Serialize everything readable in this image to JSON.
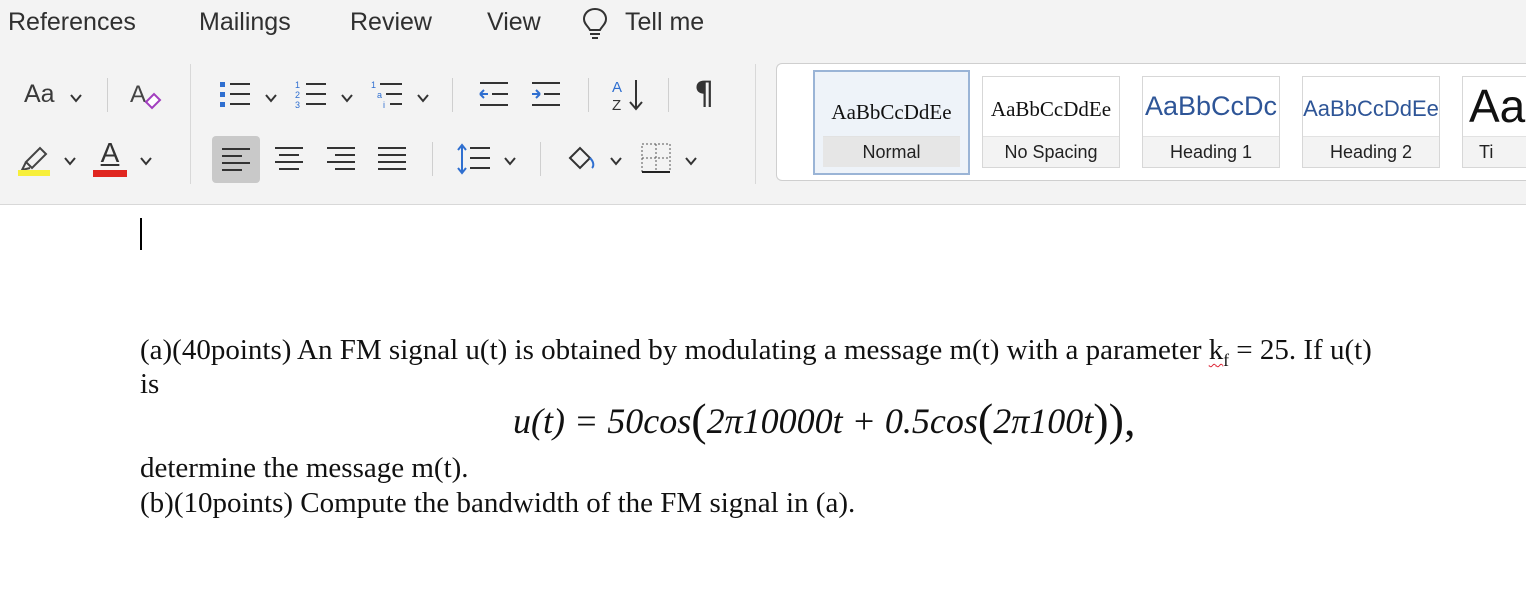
{
  "tabs": [
    {
      "label": "References"
    },
    {
      "label": "Mailings"
    },
    {
      "label": "Review"
    },
    {
      "label": "View"
    },
    {
      "label": "Tell me"
    }
  ],
  "font_size_label": "Aa",
  "font_color_letter": "A",
  "colors": {
    "highlight": "#f7ef3a",
    "font_color": "#e0261f",
    "selected_style_border": "#9ab4d6",
    "list_blue": "#2f6fd0"
  },
  "icons": [
    "lightbulb-icon",
    "clear-formatting-icon",
    "bullets-icon",
    "numbering-icon",
    "multilevel-list-icon",
    "decrease-indent-icon",
    "increase-indent-icon",
    "sort-icon",
    "pilcrow-icon",
    "highlighter-icon",
    "font-color-icon",
    "align-left-icon",
    "align-center-icon",
    "align-right-icon",
    "justify-icon",
    "line-spacing-icon",
    "shading-icon",
    "borders-icon"
  ],
  "styles": [
    {
      "preview": "AaBbCcDdEe",
      "label": "Normal"
    },
    {
      "preview": "AaBbCcDdEe",
      "label": "No Spacing"
    },
    {
      "preview": "AaBbCcDc",
      "label": "Heading 1"
    },
    {
      "preview": "AaBbCcDdEe",
      "label": "Heading 2"
    },
    {
      "preview": "Aa",
      "label": "Ti"
    }
  ],
  "document": {
    "line1_before": "(a)(40points) An FM signal u(t) is obtained by modulating a message m(t) with a parameter ",
    "kf_k": "k",
    "kf_sub": "f",
    "line1_after": " = 25. If u(t)",
    "line2": "is",
    "equation": {
      "lhs": "u(t) = 50cos",
      "inner1": "2π10000t + 0.5cos",
      "inner2": "2π100t",
      "tail": "),"
    },
    "line4": "determine the message m(t).",
    "line5": "(b)(10points) Compute the bandwidth of the FM signal in (a)."
  }
}
